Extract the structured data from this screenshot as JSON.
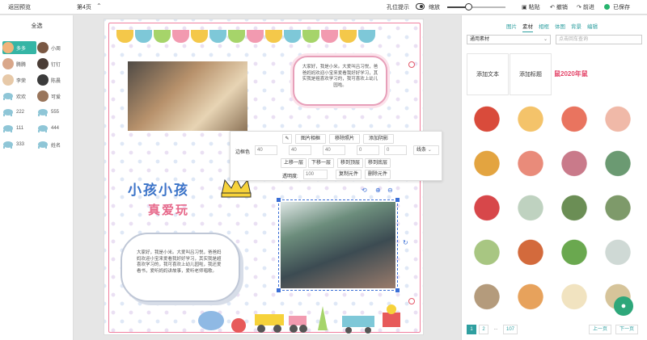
{
  "topbar": {
    "back": "返回预览",
    "page": "第4页",
    "hole_hint": "孔位提示",
    "zoom": "缩放",
    "zoom_level": 0.36,
    "paste": "粘贴",
    "undo": "撤销",
    "redo": "前进",
    "saved": "已保存"
  },
  "left": {
    "all": "全选",
    "members": [
      {
        "name": "多多",
        "selected": true,
        "icon": "avatar"
      },
      {
        "name": "小周",
        "icon": "avatar"
      },
      {
        "name": "腾腾",
        "icon": "avatar"
      },
      {
        "name": "钉钉",
        "icon": "avatar"
      },
      {
        "name": "李荣",
        "icon": "avatar"
      },
      {
        "name": "陈晨",
        "icon": "avatar"
      },
      {
        "name": "欢欢",
        "icon": "elephant"
      },
      {
        "name": "可爱",
        "icon": "avatar"
      },
      {
        "name": "222",
        "icon": "elephant"
      },
      {
        "name": "555",
        "icon": "elephant"
      },
      {
        "name": "111",
        "icon": "elephant"
      },
      {
        "name": "444",
        "icon": "elephant"
      },
      {
        "name": "333",
        "icon": "elephant"
      },
      {
        "name": "姓名",
        "icon": "elephant"
      }
    ]
  },
  "canvas": {
    "note_top": "大家好，我是小米。大爱叫吕习悦，爸爸妈妈欢迎小宝来爱看我好好学习，其实我是祖喜欢学习的，我可喜欢上幼儿园啦。",
    "title_1": "小孩小孩",
    "title_2": "真爱玩",
    "note_bottom": "大家好，我是小米。大爱叫吕习悦，爸爸妈妈欢迎小宝来爱看我好好学习，其实我是超喜欢学习的，我可喜欢上幼儿园啦，我还爱看书，爱听妈妈讲故事，爱听老师唱歌。"
  },
  "floatbar": {
    "row1": [
      "图片相框",
      "移除照片",
      "添加阴影"
    ],
    "border_color": "边框色",
    "nums": [
      "40",
      "40",
      "40",
      "0",
      "0"
    ],
    "line": "线条",
    "row3": [
      "上移一层",
      "下移一层",
      "移到顶层",
      "移到底层"
    ],
    "opacity": "透明度:",
    "opacity_val": "100",
    "copy": "复制元件",
    "delete": "删除元件"
  },
  "right": {
    "tabs": [
      "图片",
      "素材",
      "相框",
      "体图",
      "背景",
      "编辑"
    ],
    "active_tab": 1,
    "select": "通用素材",
    "search_placeholder": "点击回车查询",
    "add_text": "添加文本",
    "add_title": "添加标题",
    "banner": "鼠2020年鼠",
    "pager": [
      "1",
      "2",
      "...",
      "107"
    ],
    "prev": "上一页",
    "next": "下一页"
  },
  "colors": {
    "accent": "#2f9fa0",
    "selection": "#3b6fd6",
    "saved": "#27b46e"
  }
}
